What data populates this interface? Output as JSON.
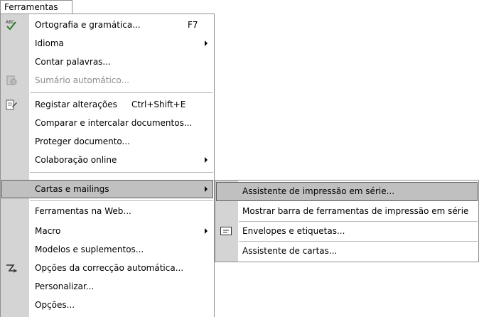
{
  "menubar": {
    "label": "Ferramentas"
  },
  "menu": {
    "items": [
      {
        "label": "Ortografia e gramática...",
        "shortcut": "F7"
      },
      {
        "label": "Idioma"
      },
      {
        "label": "Contar palavras..."
      },
      {
        "label": "Sumário automático..."
      },
      {
        "label": "Registar alterações",
        "shortcut": "Ctrl+Shift+E"
      },
      {
        "label": "Comparar e intercalar documentos..."
      },
      {
        "label": "Proteger documento..."
      },
      {
        "label": "Colaboração online"
      },
      {
        "label": "Cartas e mailings"
      },
      {
        "label": "Ferramentas na Web..."
      },
      {
        "label": "Macro"
      },
      {
        "label": "Modelos e suplementos..."
      },
      {
        "label": "Opções da correcção automática..."
      },
      {
        "label": "Personalizar..."
      },
      {
        "label": "Opções..."
      }
    ]
  },
  "submenu": {
    "items": [
      {
        "label": "Assistente de impressão em série..."
      },
      {
        "label": "Mostrar barra de ferramentas de impressão em série"
      },
      {
        "label": "Envelopes e etiquetas..."
      },
      {
        "label": "Assistente de cartas..."
      }
    ]
  },
  "icons": {
    "spelling": "abc-check-icon",
    "autosummary": "autosummary-icon",
    "track_changes": "track-changes-icon",
    "autocorrect": "autocorrect-icon",
    "envelope": "envelope-icon"
  }
}
